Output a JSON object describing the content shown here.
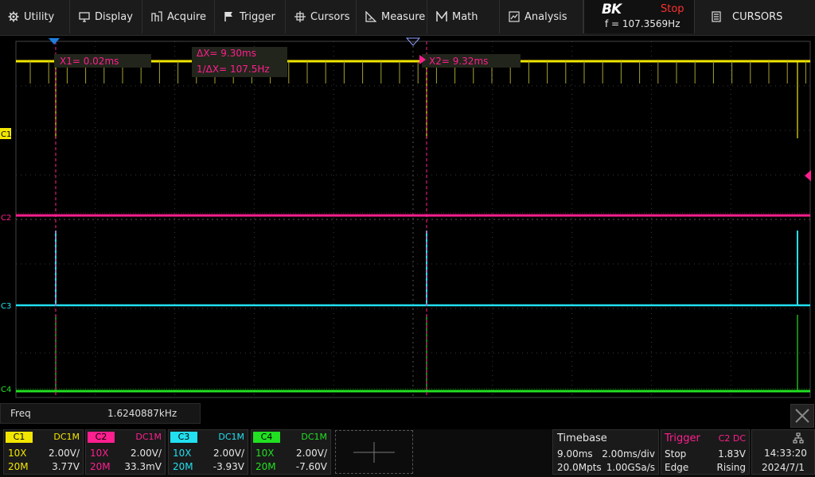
{
  "menu": {
    "items": [
      {
        "label": "Utility",
        "icon": "gear-icon"
      },
      {
        "label": "Display",
        "icon": "monitor-icon"
      },
      {
        "label": "Acquire",
        "icon": "acquire-icon"
      },
      {
        "label": "Trigger",
        "icon": "flag-icon"
      },
      {
        "label": "Cursors",
        "icon": "crosshair-icon"
      },
      {
        "label": "Measure",
        "icon": "ruler-icon"
      },
      {
        "label": "Math",
        "icon": "math-icon"
      },
      {
        "label": "Analysis",
        "icon": "analysis-icon"
      }
    ],
    "brand": "BK",
    "run_status": "Stop",
    "frequency": "f = 107.3569Hz",
    "cursors_button": "CURSORS"
  },
  "cursors": {
    "x1": "X1= 0.02ms",
    "x2": "X2= 9.32ms",
    "delta": "ΔX= 9.30ms",
    "inv_delta": "1/ΔX= 107.5Hz"
  },
  "channel_markers": [
    "C1",
    "C2",
    "C3",
    "C4"
  ],
  "measurement": {
    "label": "Freq",
    "value": "1.6240887kHz"
  },
  "channels": [
    {
      "tag": "C1",
      "coupling": "DC1M",
      "probe": "10X",
      "scale": "2.00V/",
      "bw": "20M",
      "offset": "3.77V",
      "color": "#f2e600"
    },
    {
      "tag": "C2",
      "coupling": "DC1M",
      "probe": "10X",
      "scale": "2.00V/",
      "bw": "20M",
      "offset": "33.3mV",
      "color": "#ff1f8f"
    },
    {
      "tag": "C3",
      "coupling": "DC1M",
      "probe": "10X",
      "scale": "2.00V/",
      "bw": "20M",
      "offset": "-3.93V",
      "color": "#22e0f0"
    },
    {
      "tag": "C4",
      "coupling": "DC1M",
      "probe": "10X",
      "scale": "2.00V/",
      "bw": "20M",
      "offset": "-7.60V",
      "color": "#22e022"
    }
  ],
  "timebase": {
    "title": "Timebase",
    "delay": "9.00ms",
    "scale": "2.00ms/div",
    "points": "20.0Mpts",
    "rate": "1.00GSa/s"
  },
  "trigger": {
    "title": "Trigger",
    "source": "C2 DC",
    "state": "Stop",
    "level": "1.83V",
    "type": "Edge",
    "slope": "Rising"
  },
  "clock": {
    "time": "14:33:20",
    "date": "2024/7/1"
  },
  "colors": {
    "accent_trigger": "#ff1f8f",
    "status_stop": "#ff3030"
  }
}
